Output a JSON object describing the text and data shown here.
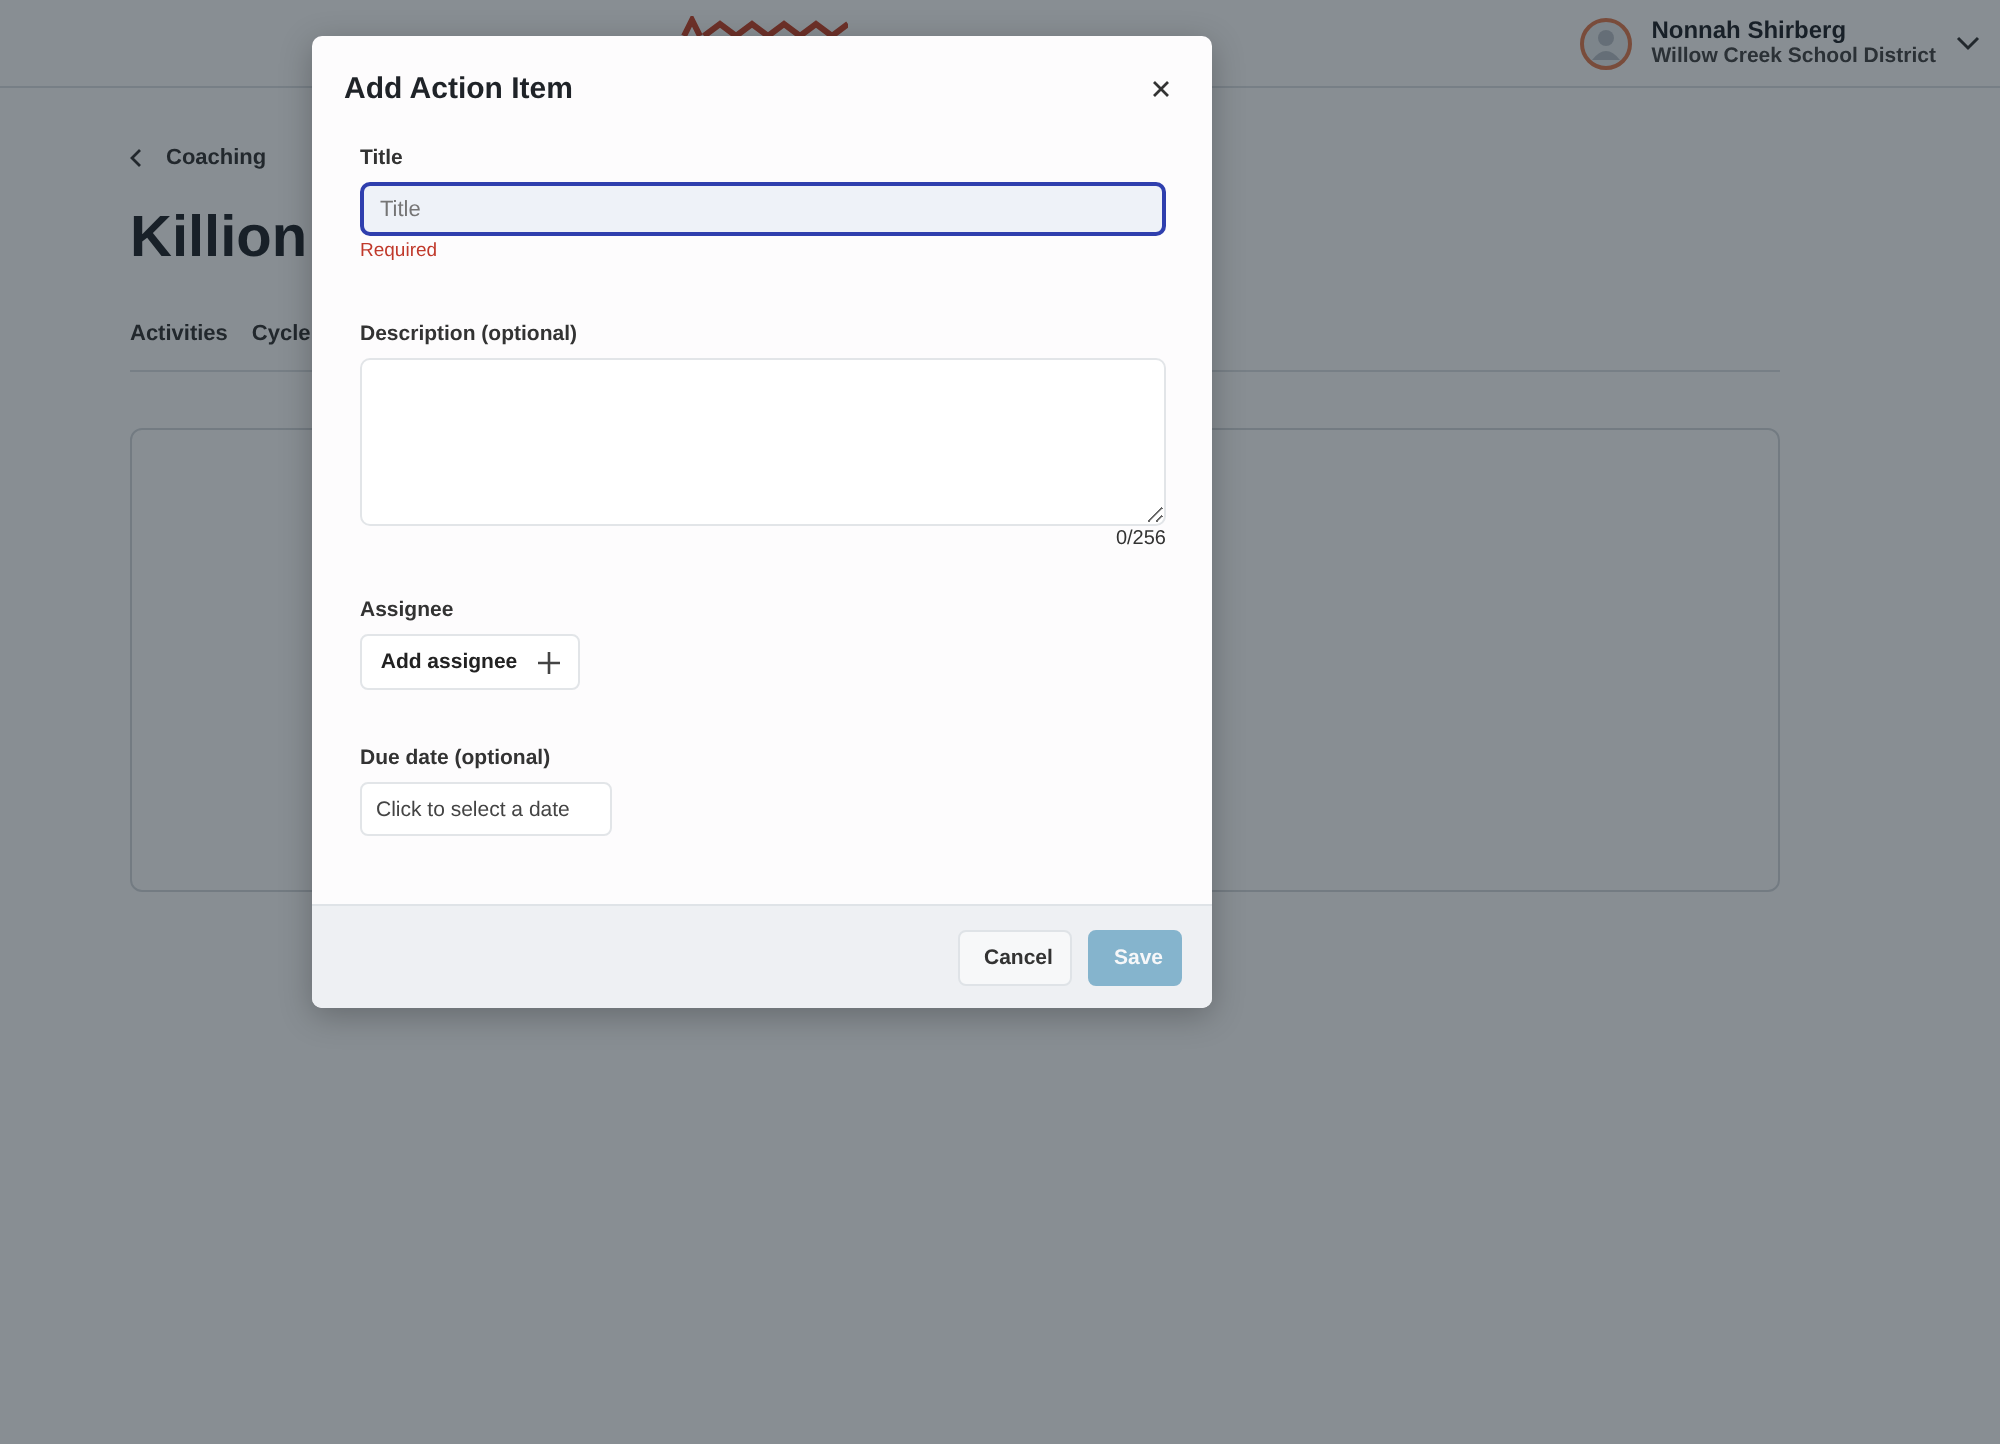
{
  "header": {
    "user": {
      "name": "Nonnah Shirberg",
      "organization": "Willow Creek School District"
    }
  },
  "page": {
    "breadcrumb": "Coaching",
    "title": "Killion",
    "tabs": [
      {
        "label": "Activities"
      },
      {
        "label": "Cycle"
      }
    ]
  },
  "dialog": {
    "title": "Add Action Item",
    "fields": [
      {
        "kind": "text",
        "label": "Title",
        "placeholder": "Title",
        "focused": true,
        "error": "Required"
      },
      {
        "kind": "textarea",
        "label": "Description (optional)",
        "counter": "0/256"
      },
      {
        "kind": "assignee",
        "label": "Assignee",
        "button": "Add assignee"
      },
      {
        "kind": "date",
        "label": "Due date (optional)",
        "placeholder": "Click to select a date"
      }
    ],
    "buttons": [
      {
        "label": "Cancel",
        "kind": "secondary",
        "disabled": false
      },
      {
        "label": "Save",
        "kind": "primary",
        "disabled": true
      }
    ]
  }
}
